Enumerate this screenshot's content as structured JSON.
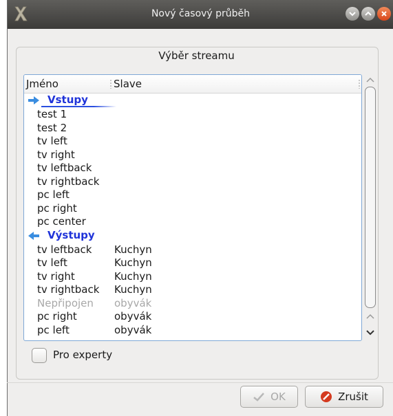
{
  "window": {
    "title": "Nový časový průběh"
  },
  "group": {
    "title": "Výběr streamu"
  },
  "list": {
    "columns": [
      "Jméno",
      "Slave"
    ],
    "groups": [
      {
        "label": "Vstupy",
        "icon": "arrow-right-icon",
        "items": [
          {
            "name": "test 1",
            "slave": ""
          },
          {
            "name": "test 2",
            "slave": ""
          },
          {
            "name": "tv left",
            "slave": ""
          },
          {
            "name": "tv right",
            "slave": ""
          },
          {
            "name": "tv leftback",
            "slave": ""
          },
          {
            "name": "tv rightback",
            "slave": ""
          },
          {
            "name": "pc left",
            "slave": ""
          },
          {
            "name": "pc right",
            "slave": ""
          },
          {
            "name": "pc center",
            "slave": ""
          }
        ]
      },
      {
        "label": "Výstupy",
        "icon": "arrow-left-icon",
        "items": [
          {
            "name": "tv leftback",
            "slave": "Kuchyn"
          },
          {
            "name": "tv left",
            "slave": "Kuchyn"
          },
          {
            "name": "tv right",
            "slave": "Kuchyn"
          },
          {
            "name": "tv rightback",
            "slave": "Kuchyn"
          },
          {
            "name": "Nepřipojen",
            "slave": "obyvák",
            "disabled": true
          },
          {
            "name": "pc right",
            "slave": "obyvák"
          },
          {
            "name": "pc left",
            "slave": "obyvák"
          }
        ]
      }
    ]
  },
  "expert": {
    "label": "Pro experty",
    "checked": false
  },
  "buttons": {
    "ok": "OK",
    "cancel": "Zrušit"
  },
  "colors": {
    "group_label": "#1f33d9",
    "selection_border": "#7ea7d6",
    "close_button": "#d9461a"
  }
}
